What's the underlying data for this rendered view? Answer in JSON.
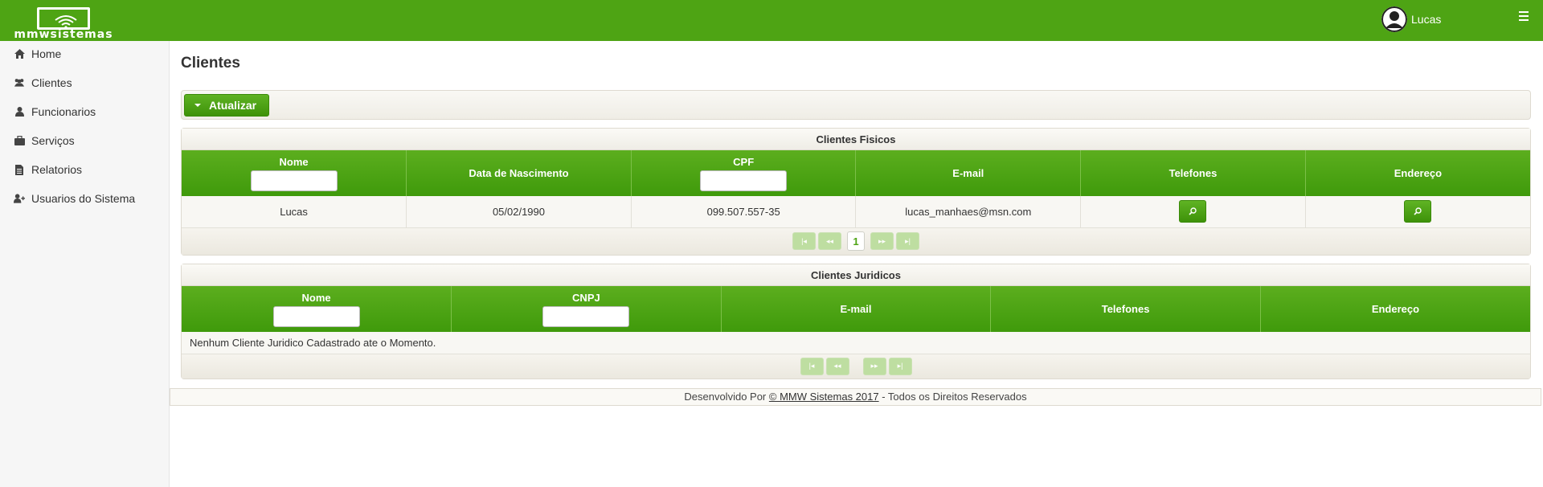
{
  "header": {
    "logo_text": "mmwsistemas",
    "user_name": "Lucas"
  },
  "sidebar": {
    "items": [
      {
        "label": "Home",
        "icon": "home-icon"
      },
      {
        "label": "Clientes",
        "icon": "users-icon"
      },
      {
        "label": "Funcionarios",
        "icon": "user-icon"
      },
      {
        "label": "Serviços",
        "icon": "briefcase-icon"
      },
      {
        "label": "Relatorios",
        "icon": "file-icon"
      },
      {
        "label": "Usuarios do Sistema",
        "icon": "user-plus-icon"
      }
    ]
  },
  "main": {
    "title": "Clientes",
    "refresh_label": "Atualizar"
  },
  "fisicos": {
    "title": "Clientes Fisicos",
    "columns": [
      "Nome",
      "Data de Nascimento",
      "CPF",
      "E-mail",
      "Telefones",
      "Endereço"
    ],
    "rows": [
      {
        "nome": "Lucas",
        "nascimento": "05/02/1990",
        "cpf": "099.507.557-35",
        "email": "lucas_manhaes@msn.com"
      }
    ],
    "current_page": "1"
  },
  "juridicos": {
    "title": "Clientes Juridicos",
    "columns": [
      "Nome",
      "CNPJ",
      "E-mail",
      "Telefones",
      "Endereço"
    ],
    "empty_message": "Nenhum Cliente Juridico Cadastrado ate o Momento."
  },
  "footer": {
    "prefix": "Desenvolvido Por ",
    "link": "© MMW Sistemas 2017",
    "suffix": " - Todos os Direitos Reservados"
  },
  "colors": {
    "brand_green": "#4ea414",
    "sidebar_bg": "#f6f6f6"
  }
}
